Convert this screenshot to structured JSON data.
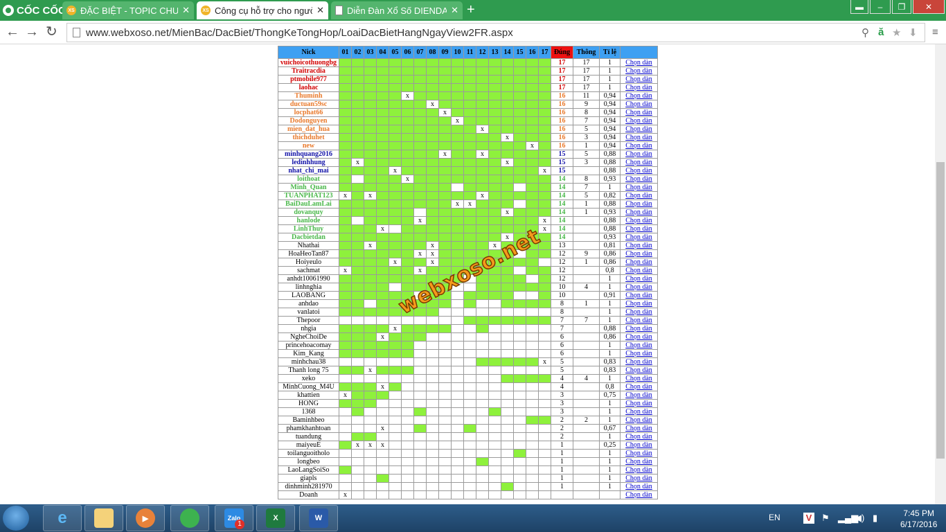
{
  "browser": {
    "logo_text": "CỐC CỐC",
    "tabs": [
      {
        "title": "ĐẶC BIỆT - TOPIC CHUYÊN",
        "icon_text": "XS",
        "active": false
      },
      {
        "title": "Công cụ hỗ trợ cho người",
        "icon_text": "XS",
        "active": true
      },
      {
        "title": "Diễn Đàn Xổ Số DIENDAN",
        "icon_text": "",
        "active": false
      }
    ],
    "url": "www.webxoso.net/MienBac/DacBiet/ThongKeTongHop/LoaiDacBietHangNgayView2FR.aspx"
  },
  "table": {
    "headers": {
      "nick": "Nick",
      "days": [
        "01",
        "02",
        "03",
        "04",
        "05",
        "06",
        "07",
        "08",
        "09",
        "10",
        "11",
        "12",
        "13",
        "14",
        "15",
        "16",
        "17"
      ],
      "dung": "Đúng",
      "thong": "Thông",
      "tile": "Tỉ lệ"
    },
    "link_label": "Chọn dàn",
    "rows": [
      {
        "nick": "vuichoicothuongbg",
        "c": "red",
        "g": "11111111111111111",
        "x": "",
        "d": "17",
        "t": "17",
        "r": "1"
      },
      {
        "nick": "Traitracdia",
        "c": "red",
        "g": "11111111111111111",
        "x": "",
        "d": "17",
        "t": "17",
        "r": "1"
      },
      {
        "nick": "ptmobile977",
        "c": "red",
        "g": "11111111111111111",
        "x": "",
        "d": "17",
        "t": "17",
        "r": "1"
      },
      {
        "nick": "laohac",
        "c": "red",
        "g": "11111111111111111",
        "x": "",
        "d": "17",
        "t": "17",
        "r": "1"
      },
      {
        "nick": "Thuminh",
        "c": "orange",
        "g": "11111011111111111",
        "x": "6",
        "d": "16",
        "t": "11",
        "r": "0,94"
      },
      {
        "nick": "ductuan59sc",
        "c": "orange",
        "g": "11111110111111111",
        "x": "8",
        "d": "16",
        "t": "9",
        "r": "0,94"
      },
      {
        "nick": "locphat66",
        "c": "orange",
        "g": "11111111011111111",
        "x": "9",
        "d": "16",
        "t": "8",
        "r": "0,94"
      },
      {
        "nick": "Dodonguyen",
        "c": "orange",
        "g": "11111111101111111",
        "x": "10",
        "d": "16",
        "t": "7",
        "r": "0,94"
      },
      {
        "nick": "mien_dat_hua",
        "c": "orange",
        "g": "11111111111011111",
        "x": "12",
        "d": "16",
        "t": "5",
        "r": "0,94"
      },
      {
        "nick": "thichduhet",
        "c": "orange",
        "g": "11111111111110111",
        "x": "14",
        "d": "16",
        "t": "3",
        "r": "0,94"
      },
      {
        "nick": "new",
        "c": "orange",
        "g": "11111111111111101",
        "x": "16",
        "d": "16",
        "t": "1",
        "r": "0,94"
      },
      {
        "nick": "minhquang2016",
        "c": "blue",
        "g": "11111111011011111",
        "x": "9,12",
        "d": "15",
        "t": "5",
        "r": "0,88"
      },
      {
        "nick": "ledinhhung",
        "c": "blue",
        "g": "10111111111110111",
        "x": "2,14",
        "d": "15",
        "t": "3",
        "r": "0,88"
      },
      {
        "nick": "nhat_chi_mai",
        "c": "blue",
        "g": "11110111111111110",
        "x": "5,17",
        "d": "15",
        "t": "",
        "r": "0,88"
      },
      {
        "nick": "loithoat",
        "c": "green",
        "g": "10111011111111111",
        "x": "6",
        "d": "14",
        "t": "8",
        "r": "0,93"
      },
      {
        "nick": "Minh_Quan",
        "c": "green",
        "g": "11111111101111011",
        "x": "",
        "d": "14",
        "t": "7",
        "r": "1"
      },
      {
        "nick": "TUANPHAT123",
        "c": "green",
        "g": "01011111111011111",
        "x": "1,3,12",
        "d": "14",
        "t": "5",
        "r": "0,82"
      },
      {
        "nick": "BaiDauLamLai",
        "c": "green",
        "g": "11111111100111011",
        "x": "10,11",
        "d": "14",
        "t": "1",
        "r": "0,88"
      },
      {
        "nick": "dovanquy",
        "c": "green",
        "g": "11111101111110111",
        "x": "14",
        "d": "14",
        "t": "1",
        "r": "0,93"
      },
      {
        "nick": "hanlode",
        "c": "green",
        "g": "10111101111111110",
        "x": "7,17",
        "d": "14",
        "t": "",
        "r": "0,88"
      },
      {
        "nick": "LinhThuy",
        "c": "green",
        "g": "11100111111111110",
        "x": "4,17",
        "d": "14",
        "t": "",
        "r": "0,88"
      },
      {
        "nick": "Dacbietdan",
        "c": "green",
        "g": "11111111111110111",
        "x": "14",
        "d": "14",
        "t": "",
        "r": "0,93"
      },
      {
        "nick": "Nhathai",
        "c": "",
        "g": "11011110111101111",
        "x": "3,8,13",
        "d": "13",
        "t": "",
        "r": "0,81"
      },
      {
        "nick": "HoaHeoTan87",
        "c": "",
        "g": "11111100111111011",
        "x": "7,8",
        "d": "12",
        "t": "9",
        "r": "0,86"
      },
      {
        "nick": "Hoiyeulo",
        "c": "",
        "g": "11110110111111110",
        "x": "5,8",
        "d": "12",
        "t": "1",
        "r": "0,86"
      },
      {
        "nick": "sachmat",
        "c": "",
        "g": "01111101111111011",
        "x": "1,7",
        "d": "12",
        "t": "",
        "r": "0,8"
      },
      {
        "nick": "anhdt10061990",
        "c": "",
        "g": "11111111110111101",
        "x": "",
        "d": "12",
        "t": "",
        "r": "1"
      },
      {
        "nick": "linhnghia",
        "c": "",
        "g": "11110111100111111",
        "x": "",
        "d": "10",
        "t": "4",
        "r": "1"
      },
      {
        "nick": "LAOBANG",
        "c": "",
        "g": "11111101101111001",
        "x": "7",
        "d": "10",
        "t": "",
        "r": "0,91"
      },
      {
        "nick": "anhdao",
        "c": "",
        "g": "11011111101001111",
        "x": "",
        "d": "8",
        "t": "1",
        "r": "1"
      },
      {
        "nick": "vanlatoi",
        "c": "",
        "g": "11111111000000000",
        "x": "",
        "d": "8",
        "t": "",
        "r": "1"
      },
      {
        "nick": "Thepoor",
        "c": "",
        "g": "00000000001111111",
        "x": "",
        "d": "7",
        "t": "7",
        "r": "1"
      },
      {
        "nick": "nhgia",
        "c": "",
        "g": "11110111100100000",
        "x": "5",
        "d": "7",
        "t": "",
        "r": "0,88"
      },
      {
        "nick": "NgheChoiDe",
        "c": "",
        "g": "11101110000000000",
        "x": "4",
        "d": "6",
        "t": "",
        "r": "0,86"
      },
      {
        "nick": "princehoacomay",
        "c": "",
        "g": "11111100000000000",
        "x": "",
        "d": "6",
        "t": "",
        "r": "1"
      },
      {
        "nick": "Kim_Kang",
        "c": "",
        "g": "11111100000000000",
        "x": "",
        "d": "6",
        "t": "",
        "r": "1"
      },
      {
        "nick": "minhchau38",
        "c": "",
        "g": "00000000000111110",
        "x": "17",
        "d": "5",
        "t": "",
        "r": "0,83"
      },
      {
        "nick": "Thanh long 75",
        "c": "",
        "g": "11011100000000000",
        "x": "3",
        "d": "5",
        "t": "",
        "r": "0,83"
      },
      {
        "nick": "xeko",
        "c": "",
        "g": "00000000000001111",
        "x": "",
        "d": "4",
        "t": "4",
        "r": "1"
      },
      {
        "nick": "MinhCuong_M4U",
        "c": "",
        "g": "11101000000000000",
        "x": "4",
        "d": "4",
        "t": "",
        "r": "0,8"
      },
      {
        "nick": "khattien",
        "c": "",
        "g": "01110000000000000",
        "x": "1",
        "d": "3",
        "t": "",
        "r": "0,75"
      },
      {
        "nick": "HONG",
        "c": "",
        "g": "11100000000000000",
        "x": "",
        "d": "3",
        "t": "",
        "r": "1"
      },
      {
        "nick": "1368",
        "c": "",
        "g": "01000010000010000",
        "x": "",
        "d": "3",
        "t": "",
        "r": "1"
      },
      {
        "nick": "Baminhbeo",
        "c": "",
        "g": "00000000000000011",
        "x": "",
        "d": "2",
        "t": "2",
        "r": "1"
      },
      {
        "nick": "phamkhanhtoan",
        "c": "",
        "g": "00000010001000000",
        "x": "4",
        "d": "2",
        "t": "",
        "r": "0,67"
      },
      {
        "nick": "tuandung",
        "c": "",
        "g": "01100000000000000",
        "x": "",
        "d": "2",
        "t": "",
        "r": "1"
      },
      {
        "nick": "maiyeuE",
        "c": "",
        "g": "10000000000000000",
        "x": "2,3,4",
        "d": "1",
        "t": "",
        "r": "0,25"
      },
      {
        "nick": "toilanguoitholo",
        "c": "",
        "g": "00000000000000100",
        "x": "",
        "d": "1",
        "t": "",
        "r": "1"
      },
      {
        "nick": "longbeo",
        "c": "",
        "g": "00000000000100000",
        "x": "",
        "d": "1",
        "t": "",
        "r": "1"
      },
      {
        "nick": "LaoLangSoiSo",
        "c": "",
        "g": "10000000000000000",
        "x": "",
        "d": "1",
        "t": "",
        "r": "1"
      },
      {
        "nick": "giapls",
        "c": "",
        "g": "00010000000000000",
        "x": "",
        "d": "1",
        "t": "",
        "r": "1"
      },
      {
        "nick": "dinhminh281970",
        "c": "",
        "g": "00000000000001000",
        "x": "",
        "d": "1",
        "t": "",
        "r": "1"
      },
      {
        "nick": "Doanh",
        "c": "",
        "g": "00000000000000000",
        "x": "1",
        "d": "",
        "t": "",
        "r": ""
      }
    ]
  },
  "watermark": "webxoso.net",
  "taskbar": {
    "lang": "EN",
    "time": "7:45 PM",
    "date": "6/17/2016",
    "zalo_badge": "1"
  },
  "colors": {
    "green_cell": "#8ef13c",
    "header_blue": "#3ea0f2",
    "header_red": "#e11111"
  }
}
